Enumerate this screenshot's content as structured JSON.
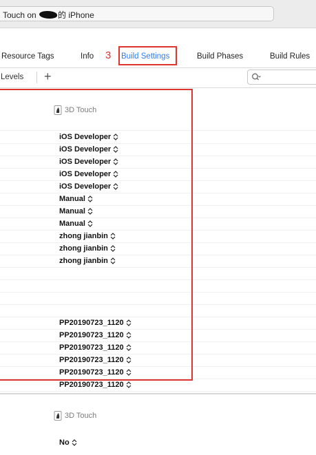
{
  "titlebar": {
    "scheme_prefix": "Touch on",
    "scheme_suffix": "的 iPhone"
  },
  "tabs": {
    "resource_tags": "Resource Tags",
    "info": "Info",
    "build_settings": "Build Settings",
    "build_phases": "Build Phases",
    "build_rules": "Build Rules"
  },
  "annotation": {
    "step": "3"
  },
  "toolbar": {
    "levels": "Levels",
    "add": "+"
  },
  "colors": {
    "accent": "#2f7cf6",
    "highlight": "#e0322f"
  },
  "section1": {
    "target_column": "3D Touch",
    "values": [
      "iOS Developer",
      "iOS Developer",
      "iOS Developer",
      "iOS Developer",
      "iOS Developer",
      "Manual",
      "Manual",
      "Manual",
      "zhong jianbin",
      "zhong jianbin",
      "zhong jianbin",
      "",
      "",
      "",
      "",
      "PP20190723_1120",
      "PP20190723_1120",
      "PP20190723_1120",
      "PP20190723_1120",
      "PP20190723_1120",
      "PP20190723_1120"
    ]
  },
  "section2": {
    "target_column": "3D Touch",
    "value": "No"
  }
}
